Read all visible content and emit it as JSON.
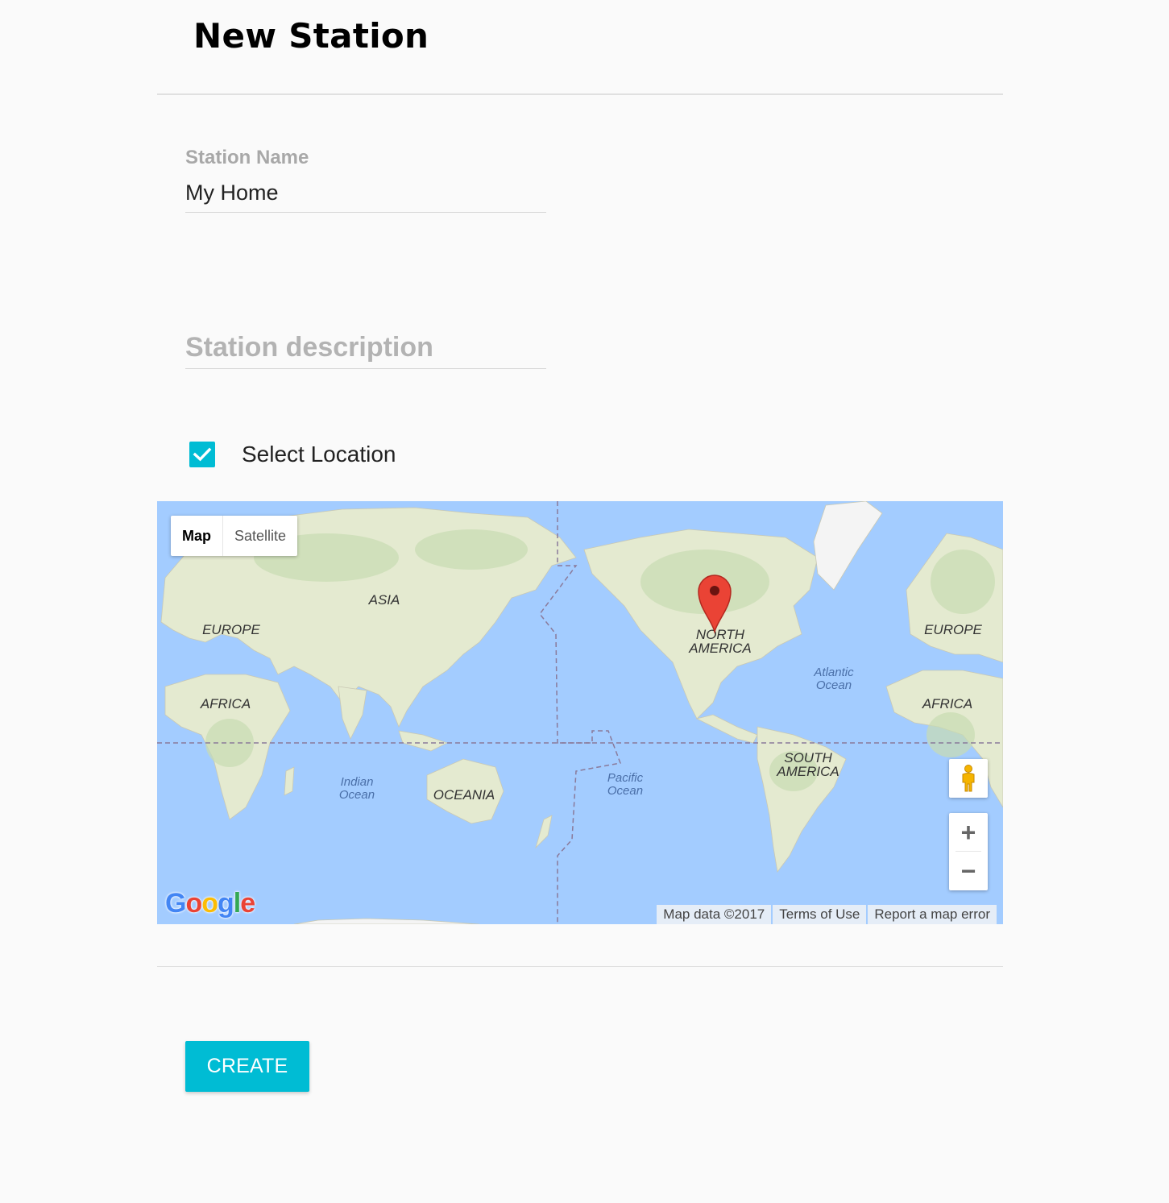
{
  "header": {
    "title": "New Station"
  },
  "form": {
    "station_name": {
      "label": "Station Name",
      "value": "My Home"
    },
    "station_description": {
      "placeholder": "Station description",
      "value": ""
    },
    "select_location": {
      "label": "Select Location",
      "checked": true
    }
  },
  "map": {
    "type_control": {
      "map_label": "Map",
      "satellite_label": "Satellite",
      "selected": "Map"
    },
    "labels": {
      "asia": "ASIA",
      "europe_left": "EUROPE",
      "africa_left": "AFRICA",
      "europe_right": "EUROPE",
      "africa_right": "AFRICA",
      "north_america_1": "NORTH",
      "north_america_2": "AMERICA",
      "south_america_1": "SOUTH",
      "south_america_2": "AMERICA",
      "oceania": "OCEANIA",
      "atlantic_1": "Atlantic",
      "atlantic_2": "Ocean",
      "pacific_1": "Pacific",
      "pacific_2": "Ocean",
      "indian_1": "Indian",
      "indian_2": "Ocean"
    },
    "zoom_in_label": "+",
    "zoom_out_label": "−",
    "logo_text": "Google",
    "attribution": {
      "map_data": "Map data ©2017",
      "terms": "Terms of Use",
      "report": "Report a map error"
    },
    "marker_icon": "map-pin-icon",
    "colors": {
      "water": "#a3ccff",
      "land": "#e6ebd0",
      "forest": "#c5dcb0",
      "ice": "#f4f4f4",
      "marker": "#ea4335"
    }
  },
  "actions": {
    "create_label": "CREATE"
  },
  "colors": {
    "accent": "#00bcd4"
  }
}
